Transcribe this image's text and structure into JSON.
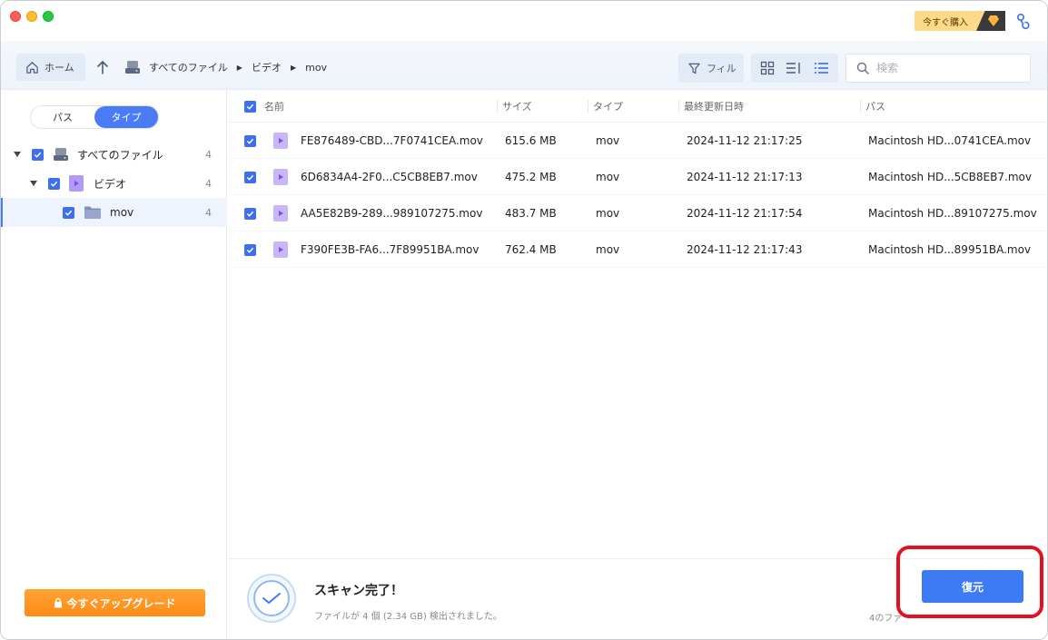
{
  "header": {
    "buy_label": "今すぐ購入",
    "accent_color": "#4a7cf6"
  },
  "toolbar": {
    "home_label": "ホーム",
    "breadcrumbs": [
      "すべてのファイル",
      "ビデオ",
      "mov"
    ],
    "filter_label": "フィル",
    "search_placeholder": "検索"
  },
  "sidebar": {
    "tabs": [
      "パス",
      "タイプ"
    ],
    "active_tab": "タイプ",
    "tree": [
      {
        "label": "すべてのファイル",
        "count": "4",
        "icon": "drive-icon"
      },
      {
        "label": "ビデオ",
        "count": "4",
        "icon": "video-icon"
      },
      {
        "label": "mov",
        "count": "4",
        "icon": "folder-icon"
      }
    ],
    "upgrade_label": "今すぐアップグレード"
  },
  "table": {
    "columns": [
      "名前",
      "サイズ",
      "タイプ",
      "最終更新日時",
      "パス"
    ],
    "rows": [
      {
        "name": "FE876489-CBD...7F0741CEA.mov",
        "size": "615.6 MB",
        "type": "mov",
        "modified": "2024-11-12 21:17:25",
        "path": "Macintosh HD...0741CEA.mov"
      },
      {
        "name": "6D6834A4-2F0...C5CB8EB7.mov",
        "size": "475.2 MB",
        "type": "mov",
        "modified": "2024-11-12 21:17:13",
        "path": "Macintosh HD...5CB8EB7.mov"
      },
      {
        "name": "AA5E82B9-289...989107275.mov",
        "size": "483.7 MB",
        "type": "mov",
        "modified": "2024-11-12 21:17:54",
        "path": "Macintosh HD...89107275.mov"
      },
      {
        "name": "F390FE3B-FA6...7F89951BA.mov",
        "size": "762.4 MB",
        "type": "mov",
        "modified": "2024-11-12 21:17:43",
        "path": "Macintosh HD...89951BA.mov"
      }
    ]
  },
  "footer": {
    "scan_title": "スキャン完了！",
    "scan_subtitle": "ファイルが 4 個 (2.34 GB) 検出されました。",
    "restore_label": "復元",
    "selected_info": "4のファ"
  }
}
